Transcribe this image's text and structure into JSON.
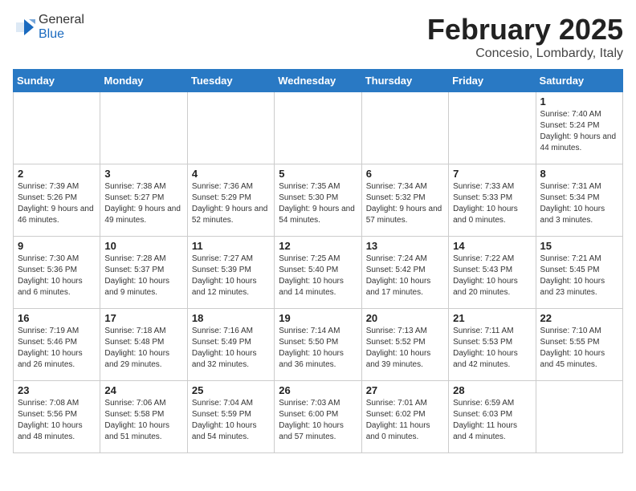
{
  "header": {
    "logo_general": "General",
    "logo_blue": "Blue",
    "month_title": "February 2025",
    "location": "Concesio, Lombardy, Italy"
  },
  "days_of_week": [
    "Sunday",
    "Monday",
    "Tuesday",
    "Wednesday",
    "Thursday",
    "Friday",
    "Saturday"
  ],
  "weeks": [
    [
      {
        "day": "",
        "info": ""
      },
      {
        "day": "",
        "info": ""
      },
      {
        "day": "",
        "info": ""
      },
      {
        "day": "",
        "info": ""
      },
      {
        "day": "",
        "info": ""
      },
      {
        "day": "",
        "info": ""
      },
      {
        "day": "1",
        "info": "Sunrise: 7:40 AM\nSunset: 5:24 PM\nDaylight: 9 hours and 44 minutes."
      }
    ],
    [
      {
        "day": "2",
        "info": "Sunrise: 7:39 AM\nSunset: 5:26 PM\nDaylight: 9 hours and 46 minutes."
      },
      {
        "day": "3",
        "info": "Sunrise: 7:38 AM\nSunset: 5:27 PM\nDaylight: 9 hours and 49 minutes."
      },
      {
        "day": "4",
        "info": "Sunrise: 7:36 AM\nSunset: 5:29 PM\nDaylight: 9 hours and 52 minutes."
      },
      {
        "day": "5",
        "info": "Sunrise: 7:35 AM\nSunset: 5:30 PM\nDaylight: 9 hours and 54 minutes."
      },
      {
        "day": "6",
        "info": "Sunrise: 7:34 AM\nSunset: 5:32 PM\nDaylight: 9 hours and 57 minutes."
      },
      {
        "day": "7",
        "info": "Sunrise: 7:33 AM\nSunset: 5:33 PM\nDaylight: 10 hours and 0 minutes."
      },
      {
        "day": "8",
        "info": "Sunrise: 7:31 AM\nSunset: 5:34 PM\nDaylight: 10 hours and 3 minutes."
      }
    ],
    [
      {
        "day": "9",
        "info": "Sunrise: 7:30 AM\nSunset: 5:36 PM\nDaylight: 10 hours and 6 minutes."
      },
      {
        "day": "10",
        "info": "Sunrise: 7:28 AM\nSunset: 5:37 PM\nDaylight: 10 hours and 9 minutes."
      },
      {
        "day": "11",
        "info": "Sunrise: 7:27 AM\nSunset: 5:39 PM\nDaylight: 10 hours and 12 minutes."
      },
      {
        "day": "12",
        "info": "Sunrise: 7:25 AM\nSunset: 5:40 PM\nDaylight: 10 hours and 14 minutes."
      },
      {
        "day": "13",
        "info": "Sunrise: 7:24 AM\nSunset: 5:42 PM\nDaylight: 10 hours and 17 minutes."
      },
      {
        "day": "14",
        "info": "Sunrise: 7:22 AM\nSunset: 5:43 PM\nDaylight: 10 hours and 20 minutes."
      },
      {
        "day": "15",
        "info": "Sunrise: 7:21 AM\nSunset: 5:45 PM\nDaylight: 10 hours and 23 minutes."
      }
    ],
    [
      {
        "day": "16",
        "info": "Sunrise: 7:19 AM\nSunset: 5:46 PM\nDaylight: 10 hours and 26 minutes."
      },
      {
        "day": "17",
        "info": "Sunrise: 7:18 AM\nSunset: 5:48 PM\nDaylight: 10 hours and 29 minutes."
      },
      {
        "day": "18",
        "info": "Sunrise: 7:16 AM\nSunset: 5:49 PM\nDaylight: 10 hours and 32 minutes."
      },
      {
        "day": "19",
        "info": "Sunrise: 7:14 AM\nSunset: 5:50 PM\nDaylight: 10 hours and 36 minutes."
      },
      {
        "day": "20",
        "info": "Sunrise: 7:13 AM\nSunset: 5:52 PM\nDaylight: 10 hours and 39 minutes."
      },
      {
        "day": "21",
        "info": "Sunrise: 7:11 AM\nSunset: 5:53 PM\nDaylight: 10 hours and 42 minutes."
      },
      {
        "day": "22",
        "info": "Sunrise: 7:10 AM\nSunset: 5:55 PM\nDaylight: 10 hours and 45 minutes."
      }
    ],
    [
      {
        "day": "23",
        "info": "Sunrise: 7:08 AM\nSunset: 5:56 PM\nDaylight: 10 hours and 48 minutes."
      },
      {
        "day": "24",
        "info": "Sunrise: 7:06 AM\nSunset: 5:58 PM\nDaylight: 10 hours and 51 minutes."
      },
      {
        "day": "25",
        "info": "Sunrise: 7:04 AM\nSunset: 5:59 PM\nDaylight: 10 hours and 54 minutes."
      },
      {
        "day": "26",
        "info": "Sunrise: 7:03 AM\nSunset: 6:00 PM\nDaylight: 10 hours and 57 minutes."
      },
      {
        "day": "27",
        "info": "Sunrise: 7:01 AM\nSunset: 6:02 PM\nDaylight: 11 hours and 0 minutes."
      },
      {
        "day": "28",
        "info": "Sunrise: 6:59 AM\nSunset: 6:03 PM\nDaylight: 11 hours and 4 minutes."
      },
      {
        "day": "",
        "info": ""
      }
    ]
  ]
}
